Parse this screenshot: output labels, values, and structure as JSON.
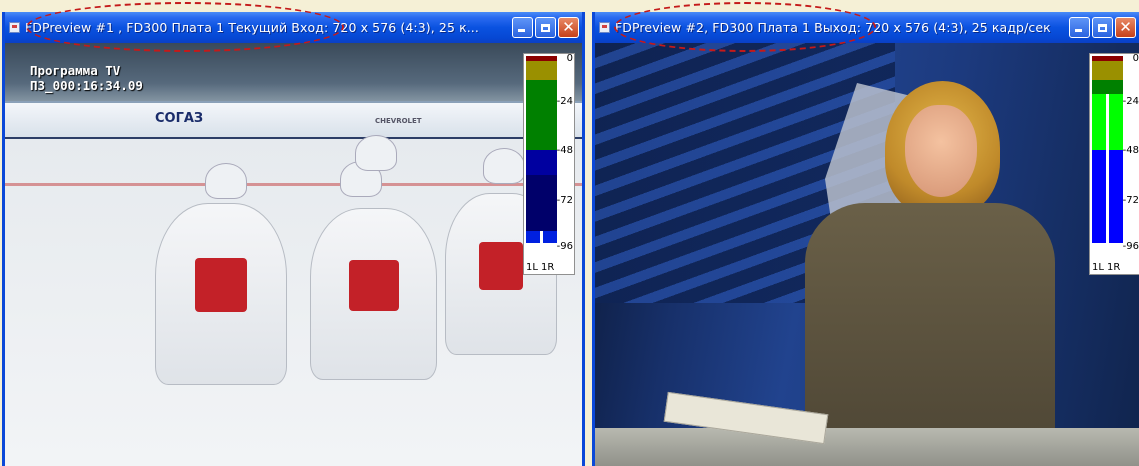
{
  "windows": [
    {
      "title": "FDPreview #1 , FD300 Плата 1 Текущий Вход: 720 x 576 (4:3), 25 к...",
      "overlay": {
        "program_label": "Программа TV",
        "timecode": "ПЗ_000:16:34.09"
      },
      "vu_meter": {
        "scale": [
          "0",
          "-24",
          "-48",
          "-72",
          "-96"
        ],
        "channels": [
          "1L",
          "1R"
        ],
        "levels": [
          -90,
          -90
        ],
        "colors": {
          "red": "#8b0000",
          "yellow": "#9a9000",
          "green": "#008000",
          "blue": "#0000a0",
          "navy": "#00006a"
        }
      },
      "rink_banner": "СОГАЗ",
      "rink_sponsor": "CHEVROLET"
    },
    {
      "title": "FDPreview #2, FD300 Плата 1 Выход: 720 x 576 (4:3), 25 кадр/сек",
      "vu_meter": {
        "scale": [
          "0",
          "-24",
          "-48",
          "-72",
          "-96"
        ],
        "channels": [
          "1L",
          "1R"
        ],
        "levels": [
          -12,
          -12
        ]
      }
    }
  ],
  "titlebar_buttons": {
    "minimize": "minimize-icon",
    "maximize": "maximize-icon",
    "close": "close-icon"
  },
  "accent": {
    "titlebar": "#0a52e0",
    "highlight": "#c41a1a",
    "background": "#f5f0d6"
  }
}
